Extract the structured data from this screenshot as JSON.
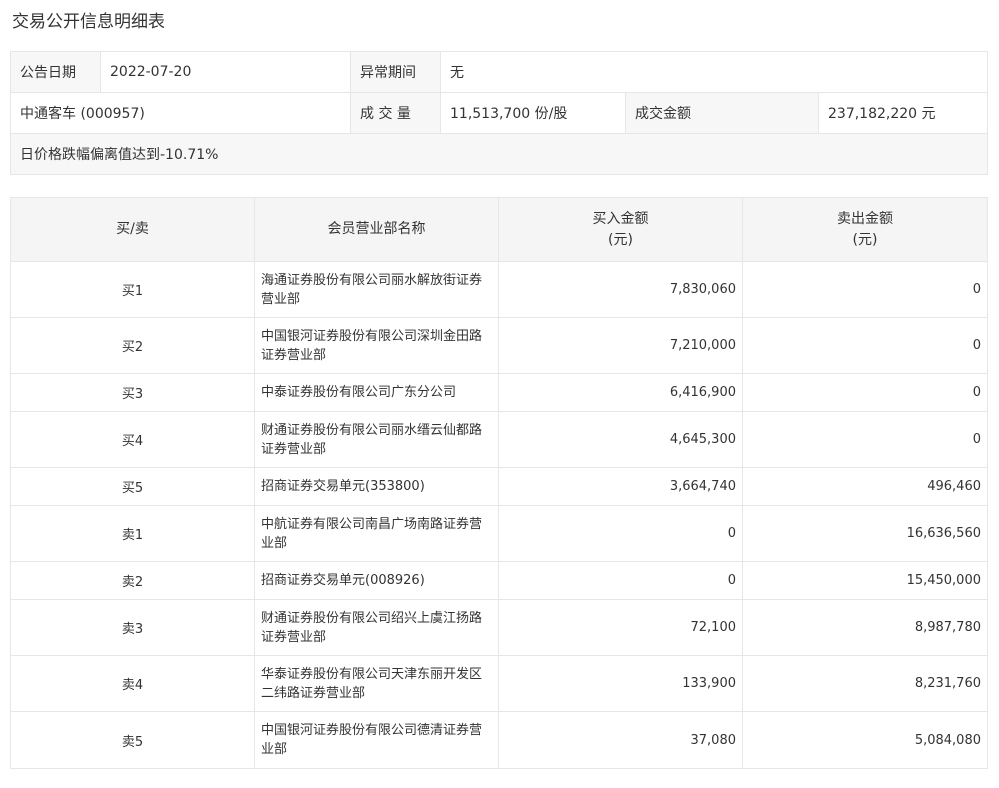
{
  "page": {
    "title": "交易公开信息明细表"
  },
  "info": {
    "announce_date_label": "公告日期",
    "announce_date_value": "2022-07-20",
    "abnormal_period_label": "异常期间",
    "abnormal_period_value": "无",
    "stock_name": "中通客车 (000957)",
    "volume_label": "成 交 量",
    "volume_value": "11,513,700 份/股",
    "turnover_label": "成交金额",
    "turnover_value": "237,182,220 元",
    "reason": "日价格跌幅偏离值达到-10.71%"
  },
  "table": {
    "headers": {
      "side": "买/卖",
      "dept": "会员营业部名称",
      "buy_line1": "买入金额",
      "buy_line2": "(元)",
      "sell_line1": "卖出金额",
      "sell_line2": "(元)"
    },
    "rows": [
      {
        "side": "买1",
        "dept": "海通证券股份有限公司丽水解放街证券营业部",
        "buy": "7,830,060",
        "sell": "0"
      },
      {
        "side": "买2",
        "dept": "中国银河证券股份有限公司深圳金田路证券营业部",
        "buy": "7,210,000",
        "sell": "0"
      },
      {
        "side": "买3",
        "dept": "中泰证券股份有限公司广东分公司",
        "buy": "6,416,900",
        "sell": "0"
      },
      {
        "side": "买4",
        "dept": "财通证券股份有限公司丽水缙云仙都路证券营业部",
        "buy": "4,645,300",
        "sell": "0"
      },
      {
        "side": "买5",
        "dept": "招商证券交易单元(353800)",
        "buy": "3,664,740",
        "sell": "496,460"
      },
      {
        "side": "卖1",
        "dept": "中航证券有限公司南昌广场南路证券营业部",
        "buy": "0",
        "sell": "16,636,560"
      },
      {
        "side": "卖2",
        "dept": "招商证券交易单元(008926)",
        "buy": "0",
        "sell": "15,450,000"
      },
      {
        "side": "卖3",
        "dept": "财通证券股份有限公司绍兴上虞江扬路证券营业部",
        "buy": "72,100",
        "sell": "8,987,780"
      },
      {
        "side": "卖4",
        "dept": "华泰证券股份有限公司天津东丽开发区二纬路证券营业部",
        "buy": "133,900",
        "sell": "8,231,760"
      },
      {
        "side": "卖5",
        "dept": "中国银河证券股份有限公司德清证券营业部",
        "buy": "37,080",
        "sell": "5,084,080"
      }
    ]
  }
}
